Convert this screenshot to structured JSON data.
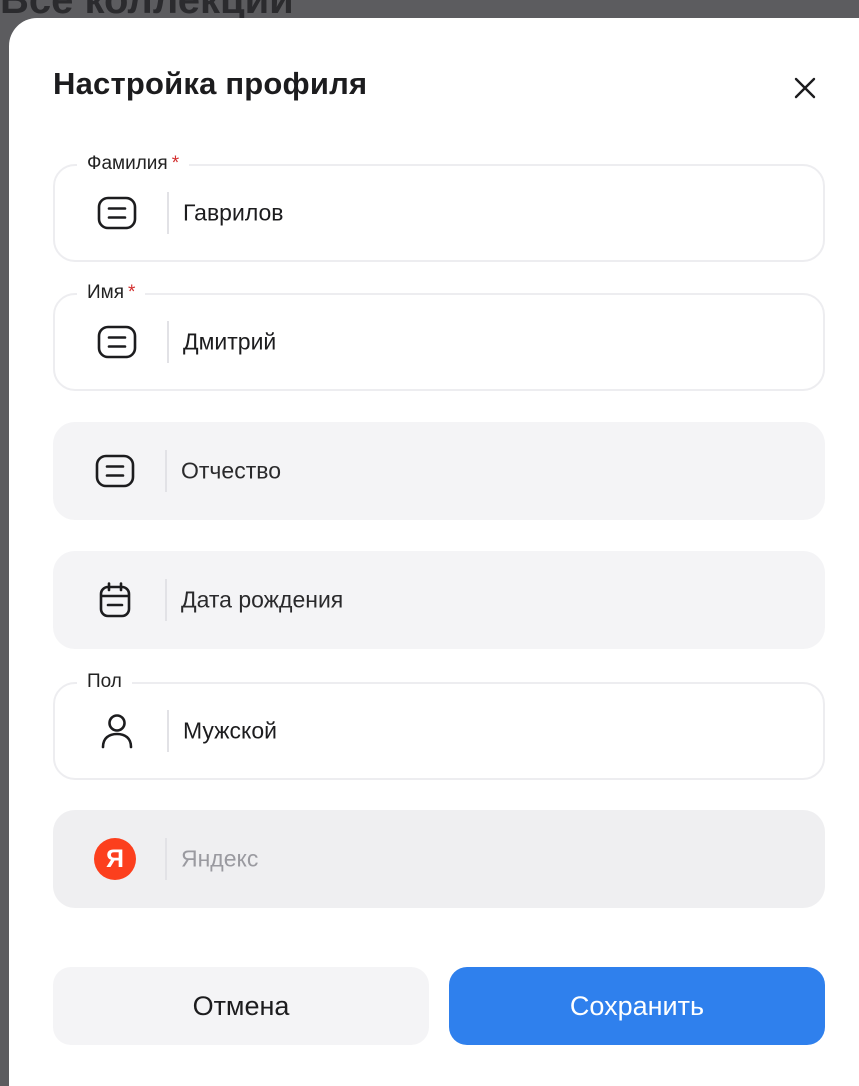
{
  "backdrop": {
    "text": "Все коллекции"
  },
  "dialog": {
    "title": "Настройка профиля",
    "close_icon": "close-icon"
  },
  "fields": {
    "last_name": {
      "label": "Фамилия",
      "required_mark": "*",
      "value": "Гаврилов",
      "icon": "text-field-icon"
    },
    "first_name": {
      "label": "Имя",
      "required_mark": "*",
      "value": "Дмитрий",
      "icon": "text-field-icon"
    },
    "patronymic": {
      "placeholder": "Отчество",
      "icon": "text-field-icon"
    },
    "birth_date": {
      "placeholder": "Дата рождения",
      "icon": "calendar-icon"
    },
    "gender": {
      "label": "Пол",
      "value": "Мужской",
      "icon": "user-icon"
    },
    "yandex": {
      "logo_letter": "Я",
      "value": "Яндекс",
      "icon": "yandex-logo"
    }
  },
  "actions": {
    "cancel_label": "Отмена",
    "save_label": "Сохранить"
  },
  "colors": {
    "accent": "#2f80ed",
    "required": "#d32f2f",
    "yandex": "#fc3f1d"
  }
}
